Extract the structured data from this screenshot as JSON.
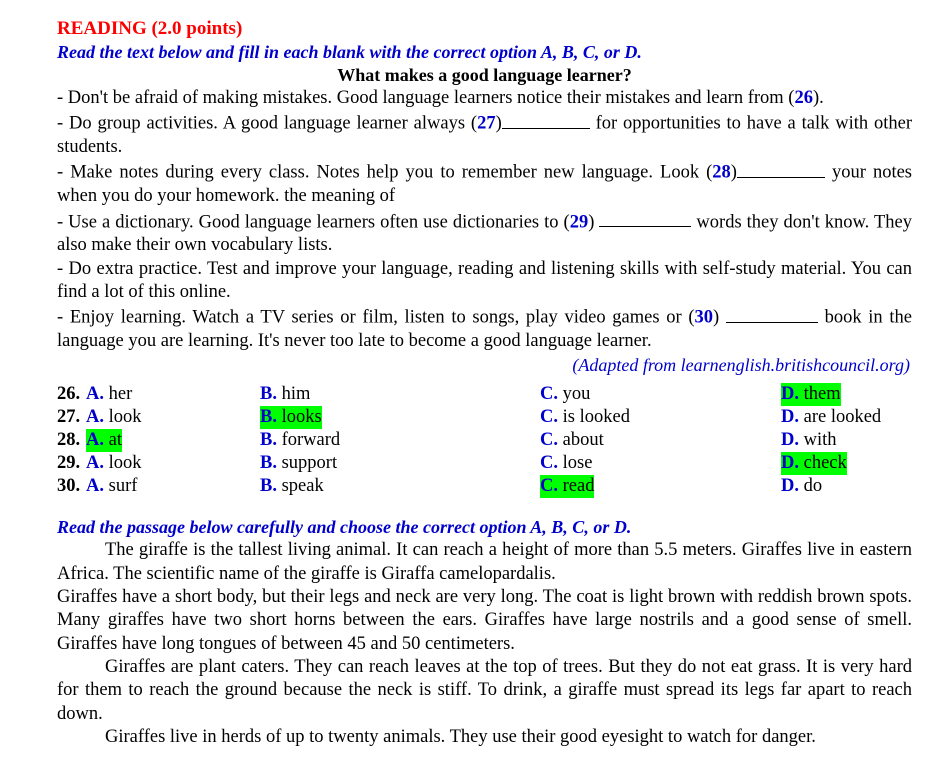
{
  "section": {
    "title": "READING (2.0 points)",
    "instruction_1": "Read the text below and fill in each blank with the correct option A, B, C, or D.",
    "passage_heading": "What makes a good language learner?",
    "instruction_2": "Read the passage below carefully and choose the correct option A, B, C, or D."
  },
  "tips": {
    "t1_before": "- Don't be afraid of making mistakes. Good language learners notice their mistakes and learn from (",
    "t1_num": "26",
    "t1_after": ").",
    "t2_before": "- Do group activities. A good language learner always (",
    "t2_num": "27",
    "t2_mid": ")",
    "t2_after": " for opportunities to have a talk with other students.",
    "t3_before": "- Make notes during every class. Notes help you to remember new language. Look (",
    "t3_num": "28",
    "t3_mid": ")",
    "t3_after": " your notes when you do your homework. the meaning of",
    "t4_before": "- Use a dictionary. Good language learners often use dictionaries to (",
    "t4_num": "29",
    "t4_mid": ") ",
    "t4_after": " words they don't know. They also make their own vocabulary lists.",
    "t5": "- Do extra practice. Test and improve your language, reading and listening skills with self-study material. You can find a lot of this online.",
    "t6_before": "- Enjoy learning. Watch a TV series or film, listen to songs, play video games or (",
    "t6_num": "30",
    "t6_mid": ") ",
    "t6_after": " book in the language you are learning. It's never too late to become a good language learner.",
    "source": "(Adapted from learnenglish.britishcouncil.org)"
  },
  "questions": [
    {
      "number": "26.",
      "options": [
        {
          "letter": "A.",
          "text": " her",
          "highlight": false
        },
        {
          "letter": "B.",
          "text": " him",
          "highlight": false
        },
        {
          "letter": "C.",
          "text": " you",
          "highlight": false
        },
        {
          "letter": "D.",
          "text": " them",
          "highlight": true
        }
      ]
    },
    {
      "number": "27.",
      "options": [
        {
          "letter": "A.",
          "text": " look",
          "highlight": false
        },
        {
          "letter": "B.",
          "text": " looks",
          "highlight": true
        },
        {
          "letter": "C.",
          "text": " is looked",
          "highlight": false
        },
        {
          "letter": "D.",
          "text": " are looked",
          "highlight": false
        }
      ]
    },
    {
      "number": "28.",
      "options": [
        {
          "letter": "A.",
          "text": " at",
          "highlight": true
        },
        {
          "letter": "B.",
          "text": " forward",
          "highlight": false
        },
        {
          "letter": "C.",
          "text": " about",
          "highlight": false
        },
        {
          "letter": "D.",
          "text": " with",
          "highlight": false
        }
      ]
    },
    {
      "number": "29.",
      "options": [
        {
          "letter": "A.",
          "text": " look",
          "highlight": false
        },
        {
          "letter": "B.",
          "text": " support",
          "highlight": false
        },
        {
          "letter": "C.",
          "text": " lose",
          "highlight": false
        },
        {
          "letter": "D.",
          "text": " check",
          "highlight": true
        }
      ]
    },
    {
      "number": "30.",
      "options": [
        {
          "letter": "A.",
          "text": " surf",
          "highlight": false
        },
        {
          "letter": "B.",
          "text": " speak",
          "highlight": false
        },
        {
          "letter": "C.",
          "text": " read",
          "highlight": true
        },
        {
          "letter": "D.",
          "text": " do",
          "highlight": false
        }
      ]
    }
  ],
  "giraffe": {
    "p1": "The giraffe is the tallest living animal. It can reach a height of more than 5.5 meters. Giraffes live in eastern Africa. The scientific name of the giraffe is Giraffa camelopardalis.",
    "p2": "Giraffes have a short body, but their legs and neck are very long. The coat is light brown with reddish brown spots. Many giraffes have two short horns between the ears. Giraffes have large nostrils and a good sense of smell. Giraffes have long tongues of between 45 and 50 centimeters.",
    "p3": "Giraffes are plant caters. They can reach leaves at the top of trees. But they do not eat grass. It is very hard for them to reach the ground because the neck is stiff. To drink, a giraffe must spread its legs far apart to reach down.",
    "p4": "Giraffes live in herds of up to twenty animals. They use their good eyesight to watch for danger."
  },
  "colors": {
    "heading_red": "#FF0000",
    "instruction_blue": "#0000CC",
    "highlight_green": "#00FF00",
    "text_black": "#000000"
  }
}
